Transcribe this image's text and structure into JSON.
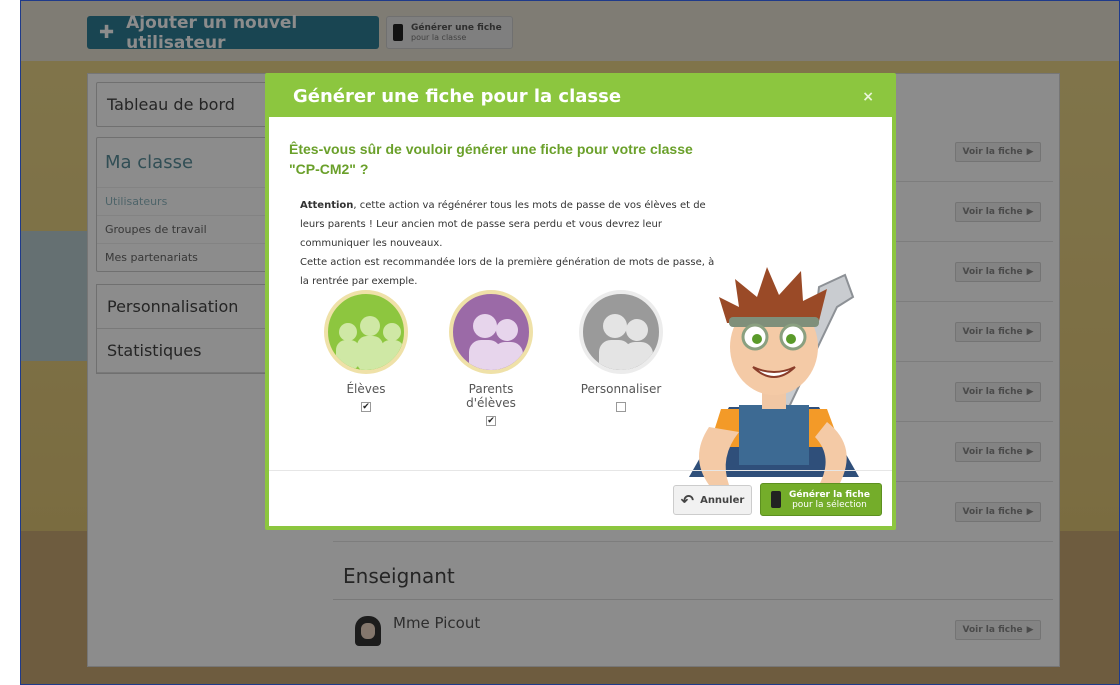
{
  "toolbar": {
    "add_user_label": "Ajouter un nouvel utilisateur",
    "sheet_line1": "Générer une fiche",
    "sheet_line2": "pour la classe"
  },
  "sidebar": {
    "dashboard": "Tableau de bord",
    "class_title": "Ma classe",
    "sub_items": [
      "Utilisateurs",
      "Groupes de travail",
      "Mes partenariats"
    ],
    "personalisation": "Personnalisation",
    "statistics": "Statistiques"
  },
  "list": {
    "voir_label": "Voir la fiche",
    "section_title": "Enseignant",
    "teacher_name": "Mme Picout"
  },
  "modal": {
    "title": "Générer une fiche pour la classe",
    "close_symbol": "×",
    "question": "Êtes-vous sûr de vouloir générer une fiche pour votre classe \"CP-CM2\" ?",
    "attention_label": "Attention",
    "paragraph_1": ", cette action va régénérer tous les mots de passe de vos élèves et de leurs parents ! Leur ancien mot de passe sera perdu et vous devrez leur communiquer les nouveaux.",
    "paragraph_2": "Cette action est recommandée lors de la première génération de mots de passe, à la rentrée par exemple.",
    "choices": [
      {
        "label": "Élèves",
        "checked": true,
        "color": "#8dc63f"
      },
      {
        "label": "Parents d'élèves",
        "checked": true,
        "color": "#9b6aa7"
      },
      {
        "label": "Personnaliser",
        "checked": false,
        "color": "#9a9a9a"
      }
    ],
    "cancel_label": "Annuler",
    "generate_line1": "Générer la fiche",
    "generate_line2": "pour la sélection"
  },
  "colors": {
    "modal_green": "#8cc63f",
    "toolbar_blue": "#2f7f95",
    "question_green": "#6aa02a"
  }
}
